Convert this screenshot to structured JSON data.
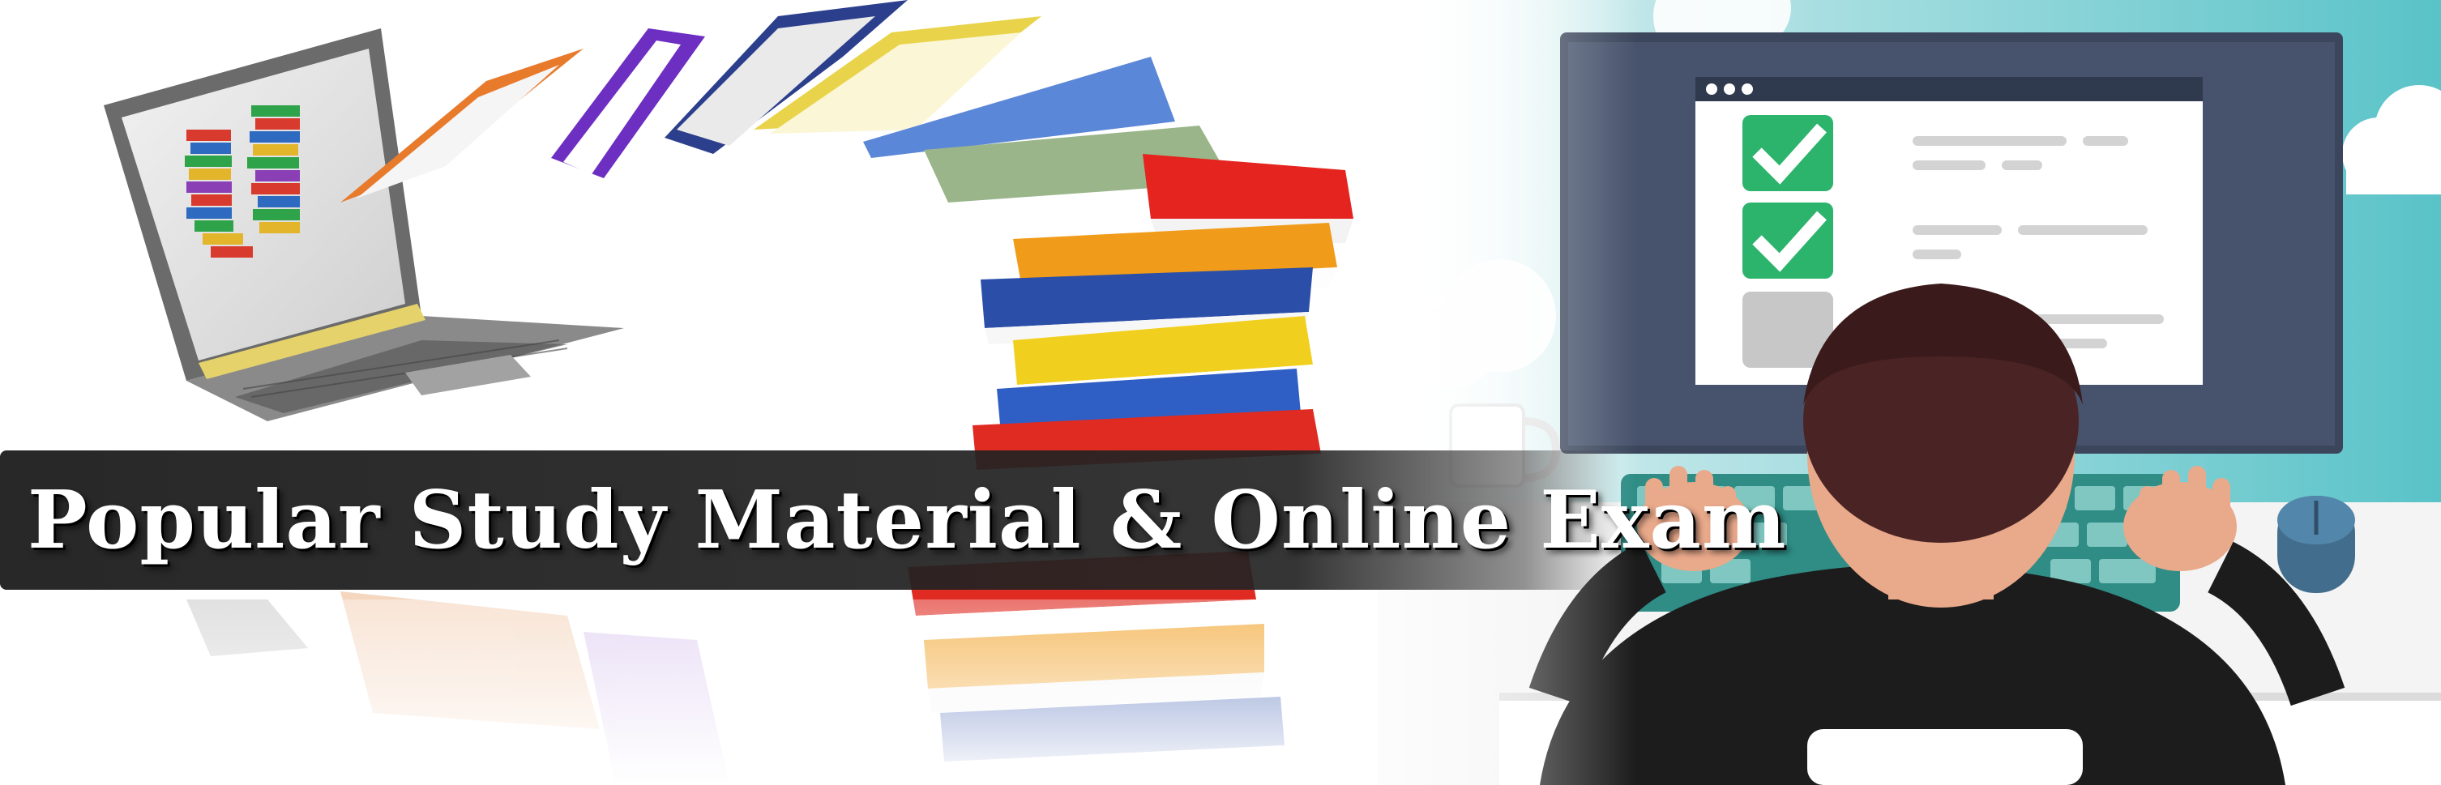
{
  "banner": {
    "title": "Popular Study Material & Online Exam",
    "icons": [
      "laptop-icon",
      "book-stack-icon",
      "checklist-monitor-icon",
      "student-at-computer-icon",
      "mouse-icon",
      "cloud-icon",
      "mug-icon"
    ]
  },
  "colors": {
    "title_text": "#ffffff",
    "title_bar": "#242424",
    "monitor_frame": "#3b465c",
    "check_green": "#2db46c",
    "sky_teal": "#5cc4c9",
    "skin": "#e9a98b",
    "hair": "#4a2424"
  }
}
